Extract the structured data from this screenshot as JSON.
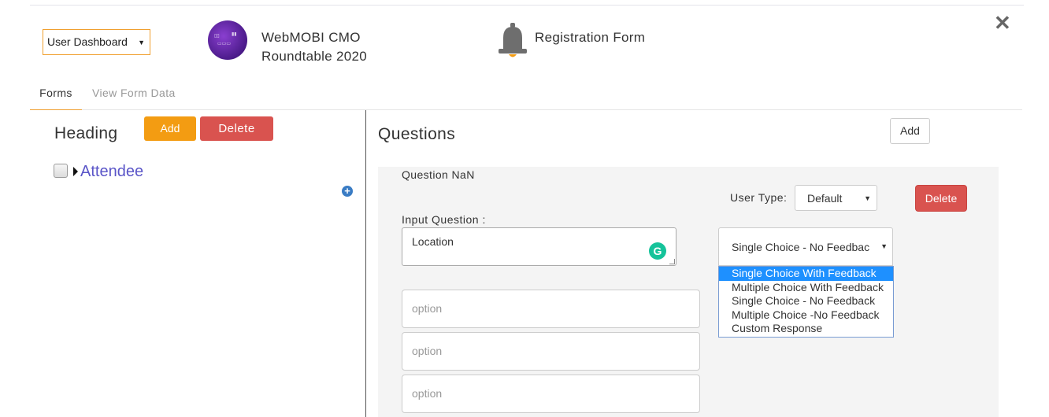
{
  "header": {
    "dashboard_select": "User Dashboard",
    "event_name": "WebMOBI CMO Roundtable 2020",
    "form_title": "Registration Form",
    "close_symbol": "✕"
  },
  "tabs": [
    {
      "label": "Forms",
      "active": true
    },
    {
      "label": "View Form Data",
      "active": false
    }
  ],
  "left_panel": {
    "heading": "Heading",
    "add_label": "Add",
    "delete_label": "Delete",
    "tree": [
      {
        "label": "Attendee",
        "checked": false
      }
    ]
  },
  "questions_panel": {
    "title": "Questions",
    "add_label": "Add",
    "question_number": "Question NaN",
    "user_type_label": "User Type:",
    "user_type_value": "Default",
    "delete_label": "Delete",
    "input_question_label": "Input Question :",
    "input_question_value": "Location",
    "question_type_value": "Single Choice - No Feedbac",
    "question_type_options": [
      "Single Choice With Feedback",
      "Multiple Choice With Feedback",
      "Single Choice - No Feedback",
      "Multiple Choice -No Feedback",
      "Custom Response"
    ],
    "highlighted_option_index": 0,
    "option_placeholder": "option",
    "options": [
      "",
      "",
      ""
    ]
  },
  "colors": {
    "accent_orange": "#f39c12",
    "danger_red": "#d9534f",
    "link_purple": "#5a55c8",
    "dropdown_highlight": "#1e90ff",
    "grammarly_green": "#15c39a"
  },
  "icons": [
    "close-icon",
    "bell-icon",
    "caret-down-icon",
    "caret-right-icon",
    "plus-circle-icon",
    "grammarly-icon",
    "checkbox-icon"
  ]
}
